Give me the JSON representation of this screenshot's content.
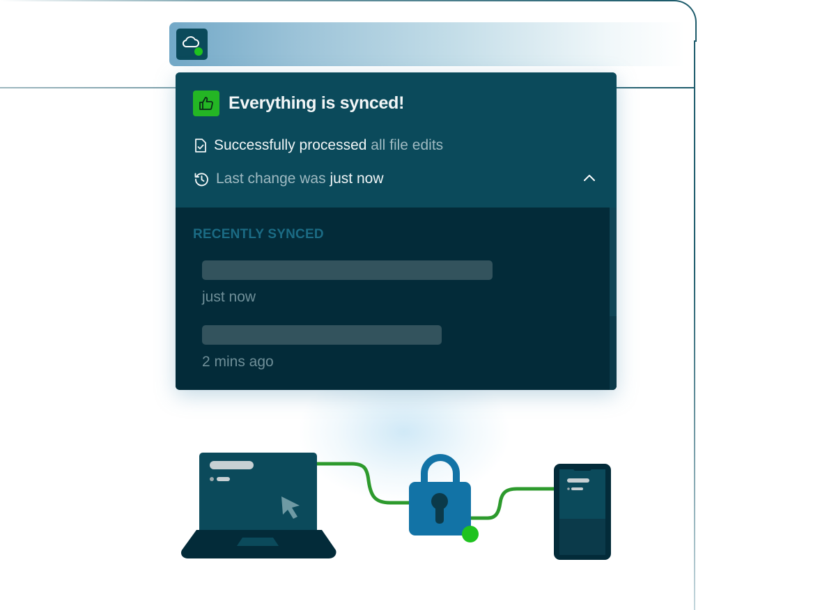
{
  "toolbar": {
    "cloud_icon": "cloud-icon",
    "status_color": "#1fc21f"
  },
  "sync_panel": {
    "title": "Everything is synced!",
    "badge_icon": "thumbs-up-icon",
    "badge_color": "#24b624",
    "processed": {
      "icon": "file-check-icon",
      "strong": "Successfully processed",
      "rest": "all file edits"
    },
    "last_change": {
      "icon": "history-icon",
      "prefix": "Last change was",
      "strong": "just now"
    },
    "toggle_icon": "chevron-up-icon",
    "recent": {
      "heading": "RECENTLY SYNCED",
      "items": [
        {
          "time": "just now"
        },
        {
          "time": "2 mins ago"
        }
      ]
    }
  },
  "illustration": {
    "devices": [
      "laptop",
      "padlock",
      "phone"
    ],
    "accent_color": "#1fc21f",
    "lock_color": "#1273a6"
  }
}
